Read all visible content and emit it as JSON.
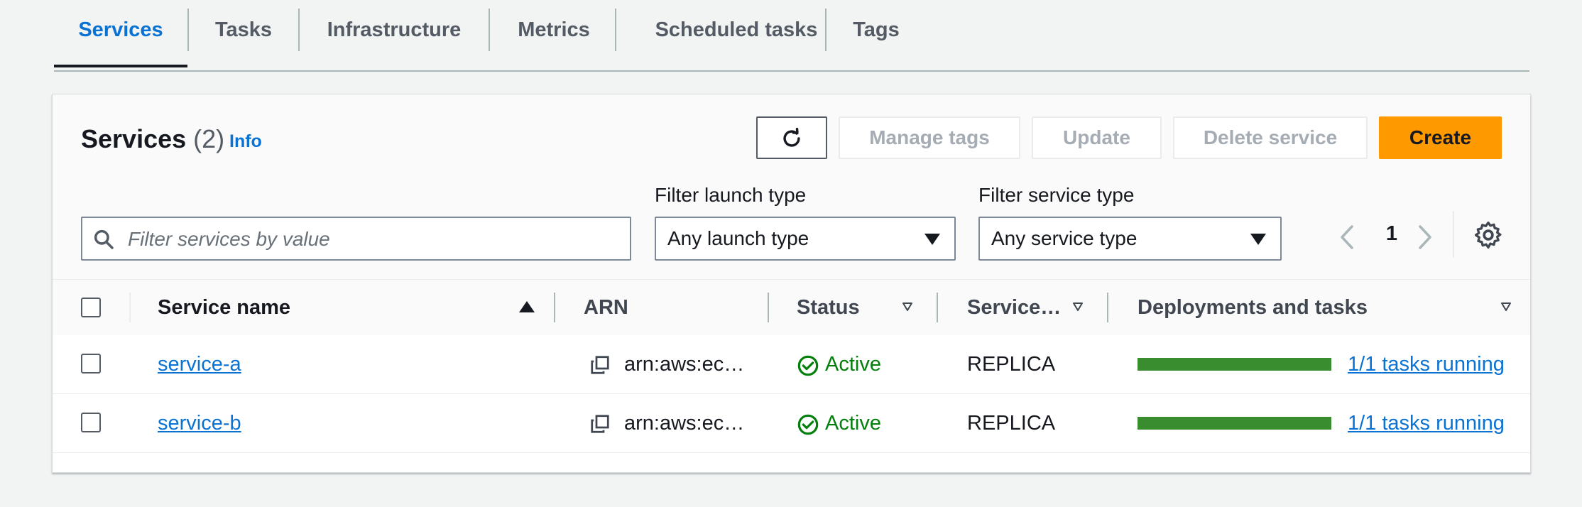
{
  "tabs": [
    {
      "label": "Services",
      "active": true
    },
    {
      "label": "Tasks"
    },
    {
      "label": "Infrastructure"
    },
    {
      "label": "Metrics"
    },
    {
      "label": "Scheduled tasks"
    },
    {
      "label": "Tags"
    }
  ],
  "header": {
    "title": "Services",
    "count": "(2)",
    "info": "Info"
  },
  "actions": {
    "manage_tags": "Manage tags",
    "update": "Update",
    "delete": "Delete service",
    "create": "Create"
  },
  "filters": {
    "search_placeholder": "Filter services by value",
    "launch_label": "Filter launch type",
    "launch_value": "Any launch type",
    "service_label": "Filter service type",
    "service_value": "Any service type"
  },
  "pagination": {
    "current_page": "1"
  },
  "table": {
    "columns": [
      "Service name",
      "ARN",
      "Status",
      "Service…",
      "Deployments and tasks"
    ],
    "rows": [
      {
        "name": "service-a",
        "arn": "arn:aws:ec…",
        "status": "Active",
        "type": "REPLICA",
        "tasks": "1/1 tasks running",
        "progress": 1.0
      },
      {
        "name": "service-b",
        "arn": "arn:aws:ec…",
        "status": "Active",
        "type": "REPLICA",
        "tasks": "1/1 tasks running",
        "progress": 1.0
      }
    ]
  },
  "colors": {
    "accent": "#0972d3",
    "create_button": "#ff9900",
    "success": "#037f0c",
    "progress_bar": "#3a8d2f"
  },
  "icons": [
    "refresh-icon",
    "search-icon",
    "caret-down-icon",
    "chevron-left-icon",
    "chevron-right-icon",
    "gear-icon",
    "sort-ascending-icon",
    "sort-descending-icon",
    "copy-icon",
    "status-success-icon"
  ]
}
